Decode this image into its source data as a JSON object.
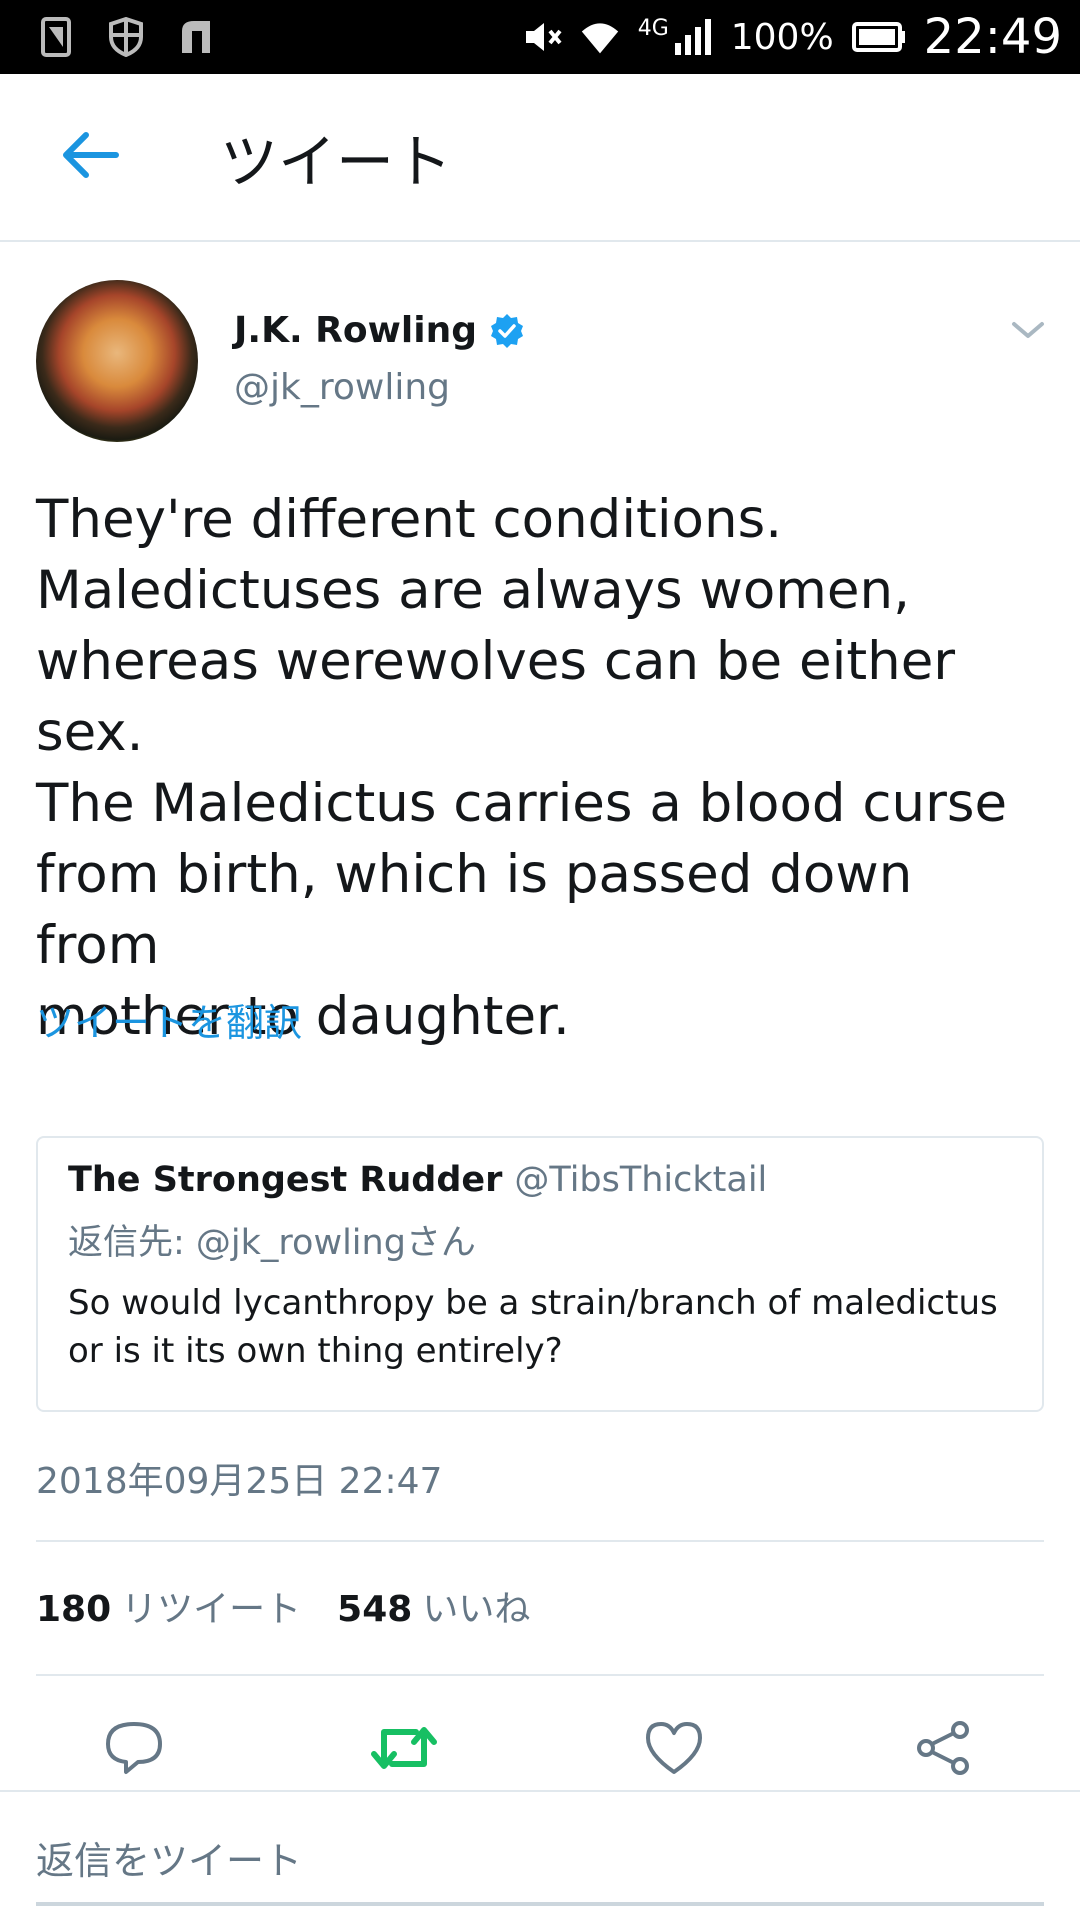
{
  "status_bar": {
    "battery_pct": "100%",
    "network": "4G",
    "time": "22:49"
  },
  "app_bar": {
    "title": "ツイート",
    "back_icon": "arrow-left-icon"
  },
  "tweet": {
    "author_name": "J.K. Rowling",
    "author_handle": "@jk_rowling",
    "verified": true,
    "text": "They're different conditions.\nMaledictuses are always women,\nwhereas werewolves can be either sex.\nThe Maledictus carries a blood curse\nfrom birth, which is passed down from\nmother to daughter.",
    "translate_label": "ツイートを翻訳",
    "timestamp": "2018年09月25日 22:47",
    "retweets_count": "180",
    "retweets_label": "リツイート",
    "likes_count": "548",
    "likes_label": "いいね"
  },
  "quoted": {
    "name": "The Strongest Rudder",
    "handle": "@TibsThicktail",
    "reply_to": "返信先: @jk_rowlingさん",
    "text": "So would lycanthropy be a strain/branch of maledictus or is it its own thing entirely?"
  },
  "actions": {
    "reply_icon": "speech-bubble-icon",
    "retweet_icon": "retweet-icon",
    "like_icon": "heart-icon",
    "share_icon": "share-icon"
  },
  "reply_bar": {
    "placeholder": "返信をツイート"
  },
  "colors": {
    "accent": "#1b95e0",
    "retweet_green": "#17bf63",
    "muted": "#657786",
    "divider": "#e1e8ed"
  }
}
